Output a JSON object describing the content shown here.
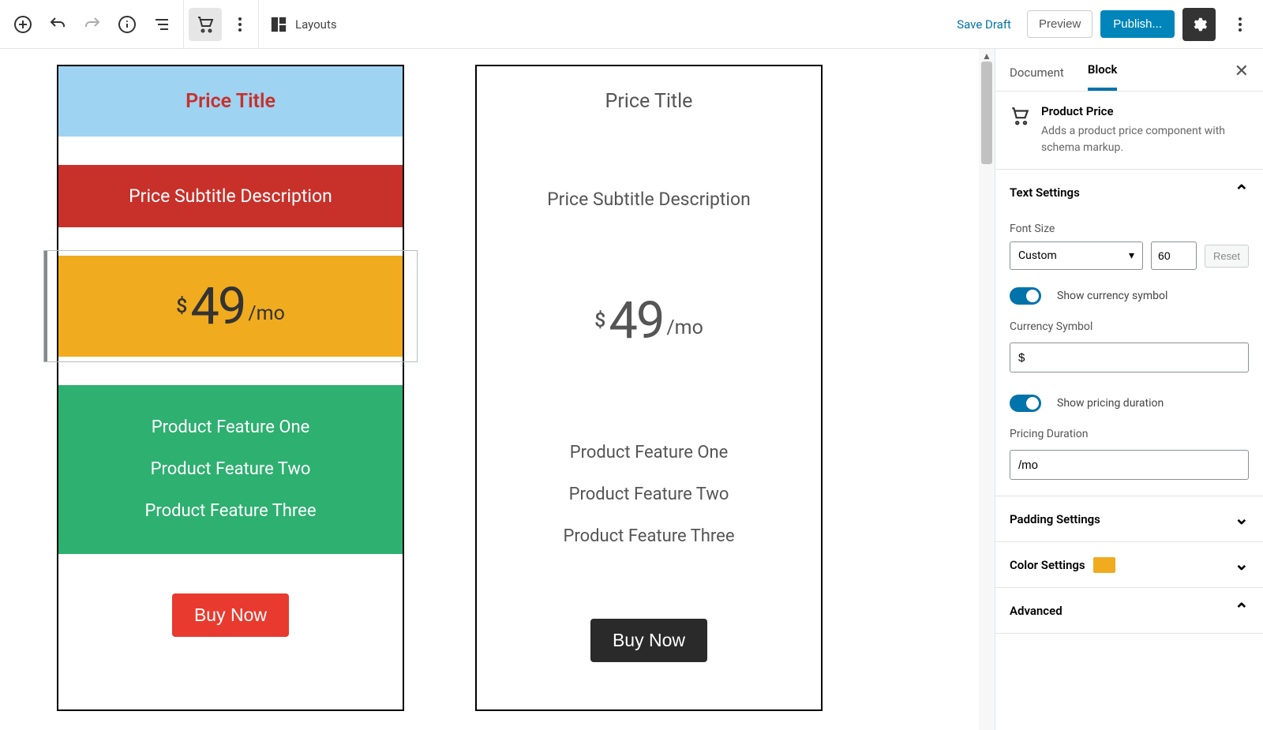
{
  "toolbar": {
    "layouts": "Layouts",
    "save_draft": "Save Draft",
    "preview": "Preview",
    "publish": "Publish..."
  },
  "cards": [
    {
      "title": "Price Title",
      "subtitle": "Price Subtitle Description",
      "currency": "$",
      "price": "49",
      "duration": "/mo",
      "features": [
        "Product Feature One",
        "Product Feature Two",
        "Product Feature Three"
      ],
      "cta": "Buy Now"
    },
    {
      "title": "Price Title",
      "subtitle": "Price Subtitle Description",
      "currency": "$",
      "price": "49",
      "duration": "/mo",
      "features": [
        "Product Feature One",
        "Product Feature Two",
        "Product Feature Three"
      ],
      "cta": "Buy Now"
    }
  ],
  "sidebar": {
    "tabs": {
      "document": "Document",
      "block": "Block"
    },
    "block_info": {
      "title": "Product Price",
      "desc": "Adds a product price component with schema markup."
    },
    "panels": {
      "text_settings": {
        "title": "Text Settings",
        "font_size_label": "Font Size",
        "font_size_select": "Custom",
        "font_size_value": "60",
        "reset": "Reset",
        "show_currency_label": "Show currency symbol",
        "currency_symbol_label": "Currency Symbol",
        "currency_symbol_value": "$",
        "show_duration_label": "Show pricing duration",
        "pricing_duration_label": "Pricing Duration",
        "pricing_duration_value": "/mo"
      },
      "padding": "Padding Settings",
      "color": "Color Settings",
      "advanced": "Advanced"
    }
  }
}
